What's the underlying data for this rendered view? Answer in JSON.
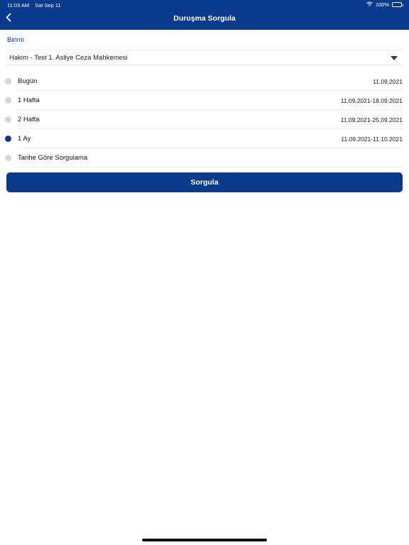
{
  "status_bar": {
    "time": "11:03 AM",
    "date": "Sat Sep 11",
    "battery": "100%",
    "icons": [
      "wifi-icon",
      "battery-icon"
    ]
  },
  "nav": {
    "title": "Duruşma Sorgula",
    "back_icon": "chevron-left-icon"
  },
  "colors": {
    "primary": "#0a3a8c",
    "radio_off": "#d6d6d6"
  },
  "unit": {
    "label": "Birimi",
    "selected": "Hakim - Test 1. Asliye Ceza Mahkemesi",
    "caret_icon": "caret-down-icon"
  },
  "periods": [
    {
      "label": "Bugün",
      "range": "11.09.2021",
      "selected": false
    },
    {
      "label": "1 Hafta",
      "range": "11.09.2021-18.09.2021",
      "selected": false
    },
    {
      "label": "2 Hafta",
      "range": "11.09.2021-25.09.2021",
      "selected": false
    },
    {
      "label": "1 Ay",
      "range": "11.09.2021-11.10.2021",
      "selected": true
    },
    {
      "label": "Tarihe Göre Sorgulama",
      "range": "",
      "selected": false
    }
  ],
  "submit_label": "Sorgula"
}
